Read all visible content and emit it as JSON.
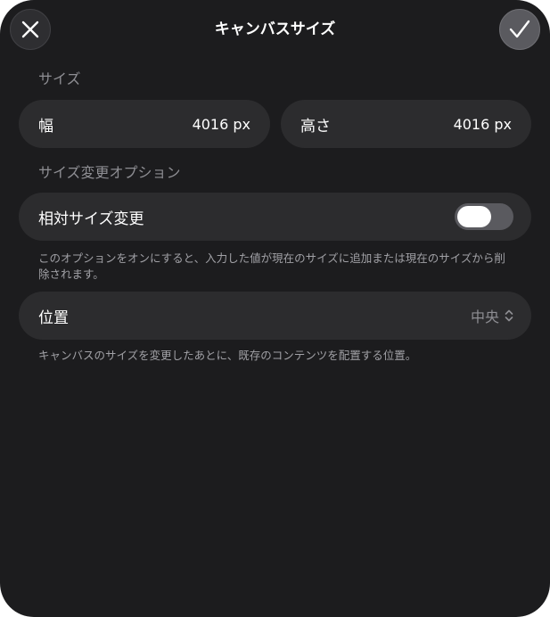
{
  "header": {
    "title": "キャンバスサイズ",
    "close_icon": "close-icon",
    "confirm_icon": "checkmark-icon"
  },
  "size_section": {
    "label": "サイズ",
    "width": {
      "label": "幅",
      "value": "4016 px"
    },
    "height": {
      "label": "高さ",
      "value": "4016 px"
    }
  },
  "options_section": {
    "label": "サイズ変更オプション",
    "relative": {
      "label": "相対サイズ変更",
      "enabled": false,
      "help": "このオプションをオンにすると、入力した値が現在のサイズに追加または現在のサイズから削除されます。"
    },
    "position": {
      "label": "位置",
      "value": "中央",
      "icon": "chevron-up-down-icon",
      "help": "キャンバスのサイズを変更したあとに、既存のコンテンツを配置する位置。"
    }
  },
  "colors": {
    "background": "#1c1c1e",
    "field": "#2c2c2e",
    "secondary_text": "#8e8e93"
  }
}
